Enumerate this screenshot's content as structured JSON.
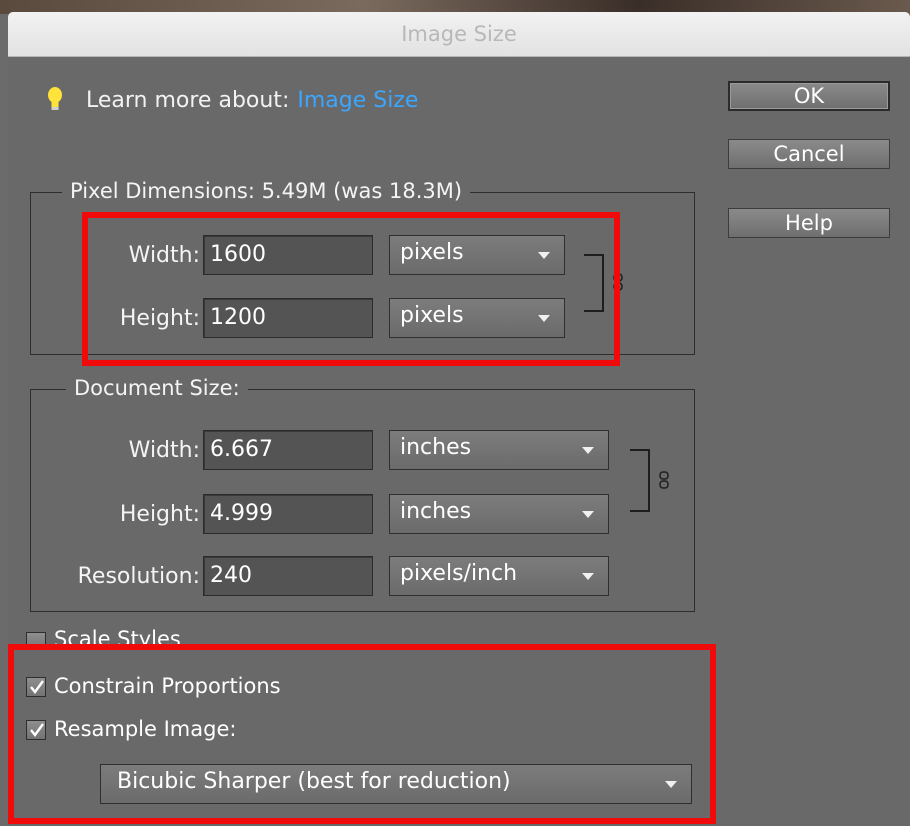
{
  "window": {
    "title": "Image Size"
  },
  "learn": {
    "prefix": "Learn more about:",
    "link": "Image Size",
    "icon": "lightbulb-icon"
  },
  "buttons": {
    "ok": "OK",
    "cancel": "Cancel",
    "help": "Help"
  },
  "pixel_dimensions": {
    "legend": "Pixel Dimensions:  5.49M (was 18.3M)",
    "width_label": "Width:",
    "width_value": "1600",
    "width_unit": "pixels",
    "height_label": "Height:",
    "height_value": "1200",
    "height_unit": "pixels"
  },
  "document_size": {
    "legend": "Document Size:",
    "width_label": "Width:",
    "width_value": "6.667",
    "width_unit": "inches",
    "height_label": "Height:",
    "height_value": "4.999",
    "height_unit": "inches",
    "resolution_label": "Resolution:",
    "resolution_value": "240",
    "resolution_unit": "pixels/inch"
  },
  "options": {
    "scale_styles": {
      "label": "Scale Styles",
      "checked": false
    },
    "constrain": {
      "label": "Constrain Proportions",
      "checked": true
    },
    "resample": {
      "label": "Resample Image:",
      "checked": true
    },
    "resample_method": "Bicubic Sharper (best for reduction)"
  },
  "colors": {
    "highlight_red": "#f00a0a",
    "link_blue": "#3ba6ff",
    "dialog_bg": "#696969"
  }
}
